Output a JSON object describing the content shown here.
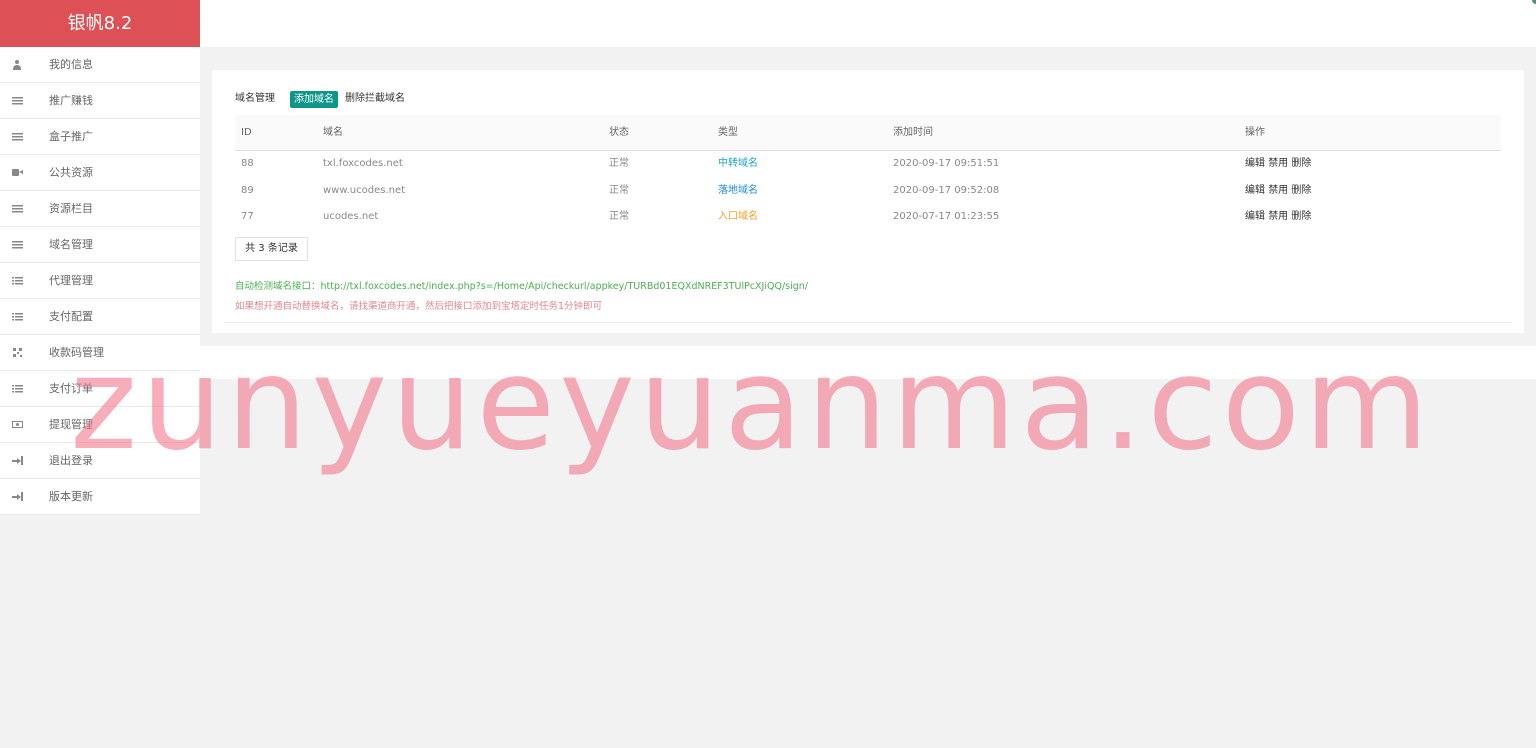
{
  "app": {
    "brand": "银帆8.2"
  },
  "sidebar": {
    "items": [
      {
        "label": "我的信息",
        "icon": "user-icon"
      },
      {
        "label": "推广赚钱",
        "icon": "list-icon"
      },
      {
        "label": "盒子推广",
        "icon": "list-icon"
      },
      {
        "label": "公共资源",
        "icon": "video-icon"
      },
      {
        "label": "资源栏目",
        "icon": "list-icon"
      },
      {
        "label": "域名管理",
        "icon": "list-icon"
      },
      {
        "label": "代理管理",
        "icon": "list-ul-icon"
      },
      {
        "label": "支付配置",
        "icon": "list-ul-icon"
      },
      {
        "label": "收款码管理",
        "icon": "qrcode-icon"
      },
      {
        "label": "支付订单",
        "icon": "list-ul-icon"
      },
      {
        "label": "提现管理",
        "icon": "money-icon"
      },
      {
        "label": "退出登录",
        "icon": "sign-out-icon"
      },
      {
        "label": "版本更新",
        "icon": "sign-out-icon"
      }
    ]
  },
  "card": {
    "title": "域名管理",
    "add_button": "添加域名",
    "delete_blocked": "删除拦截域名"
  },
  "table": {
    "headers": [
      "ID",
      "域名",
      "状态",
      "类型",
      "添加时间",
      "操作"
    ],
    "rows": [
      {
        "id": "88",
        "domain": "txl.foxcodes.net",
        "status": "正常",
        "type": "中转域名",
        "type_color": "#1aa5c9",
        "time": "2020-09-17 09:51:51",
        "edit": "编辑",
        "disable": "禁用",
        "delete": "删除"
      },
      {
        "id": "89",
        "domain": "www.ucodes.net",
        "status": "正常",
        "type": "落地域名",
        "type_color": "#1e88e5",
        "time": "2020-09-17 09:52:08",
        "edit": "编辑",
        "disable": "禁用",
        "delete": "删除"
      },
      {
        "id": "77",
        "domain": "ucodes.net",
        "status": "正常",
        "type": "入口域名",
        "type_color": "#f0a020",
        "time": "2020-07-17 01:23:55",
        "edit": "编辑",
        "disable": "禁用",
        "delete": "删除"
      }
    ]
  },
  "footer": {
    "count": "共 3 条记录",
    "api_note": "自动检测域名接口：http://txl.foxcodes.net/index.php?s=/Home/Api/checkurl/appkey/TURBd01EQXdNREF3TUlPcXJiQQ/sign/",
    "tip_note": "如果想开通自动替换域名，请找渠道商开通，然后把接口添加到宝塔定时任务1分钟即可"
  },
  "colors": {
    "brand": "#dd5055",
    "accent": "#0e9788",
    "success": "#4caf50",
    "warning_text": "#e2888c"
  },
  "watermark": "zunyueyuanma.com"
}
